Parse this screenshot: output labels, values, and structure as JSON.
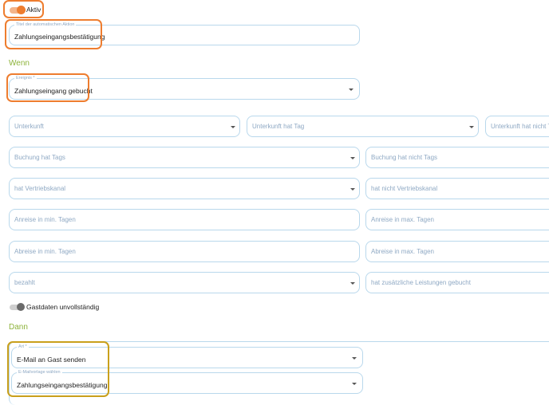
{
  "toggle_active": {
    "label": "Aktiv",
    "on": true
  },
  "title_field": {
    "label": "Titel der automatischen Aktion",
    "value": "Zahlungseingangsbestätigung"
  },
  "section_when": "Wenn",
  "event_field": {
    "label": "Ereignis *",
    "value": "Zahlungseingang gebucht"
  },
  "filters": {
    "unterkunft": "Unterkunft",
    "unterkunft_hat_tag": "Unterkunft hat Tag",
    "unterkunft_hat_nicht_tag": "Unterkunft hat nicht Ta",
    "buchung_hat_tags": "Buchung hat Tags",
    "buchung_hat_nicht_tags": "Buchung hat nicht Tags",
    "hat_vertriebskanal": "hat Vertriebskanal",
    "hat_nicht_vertriebskanal": "hat nicht Vertriebskanal",
    "anreise_min": "Anreise in min. Tagen",
    "anreise_max": "Anreise in max. Tagen",
    "abreise_min": "Abreise in min. Tagen",
    "abreise_max": "Abreise in max. Tagen",
    "bezahlt": "bezahlt",
    "zusaetzliche_leistungen": "hat zusätzliche Leistungen gebucht"
  },
  "toggle_guest_data": {
    "label": "Gastdaten unvollständig",
    "on": false
  },
  "section_then": "Dann",
  "action_field": {
    "label": "Art *",
    "value": "E-Mail an Gast senden"
  },
  "template_field": {
    "label": "E-Mailvorlage wählen",
    "value": "Zahlungseingangsbestätigung"
  },
  "colors": {
    "accent_orange": "#ee7d2f",
    "section_green": "#8db33a",
    "highlight_olive": "#c9a01c",
    "field_border": "#b9d8ec",
    "placeholder": "#8fa9c4"
  }
}
